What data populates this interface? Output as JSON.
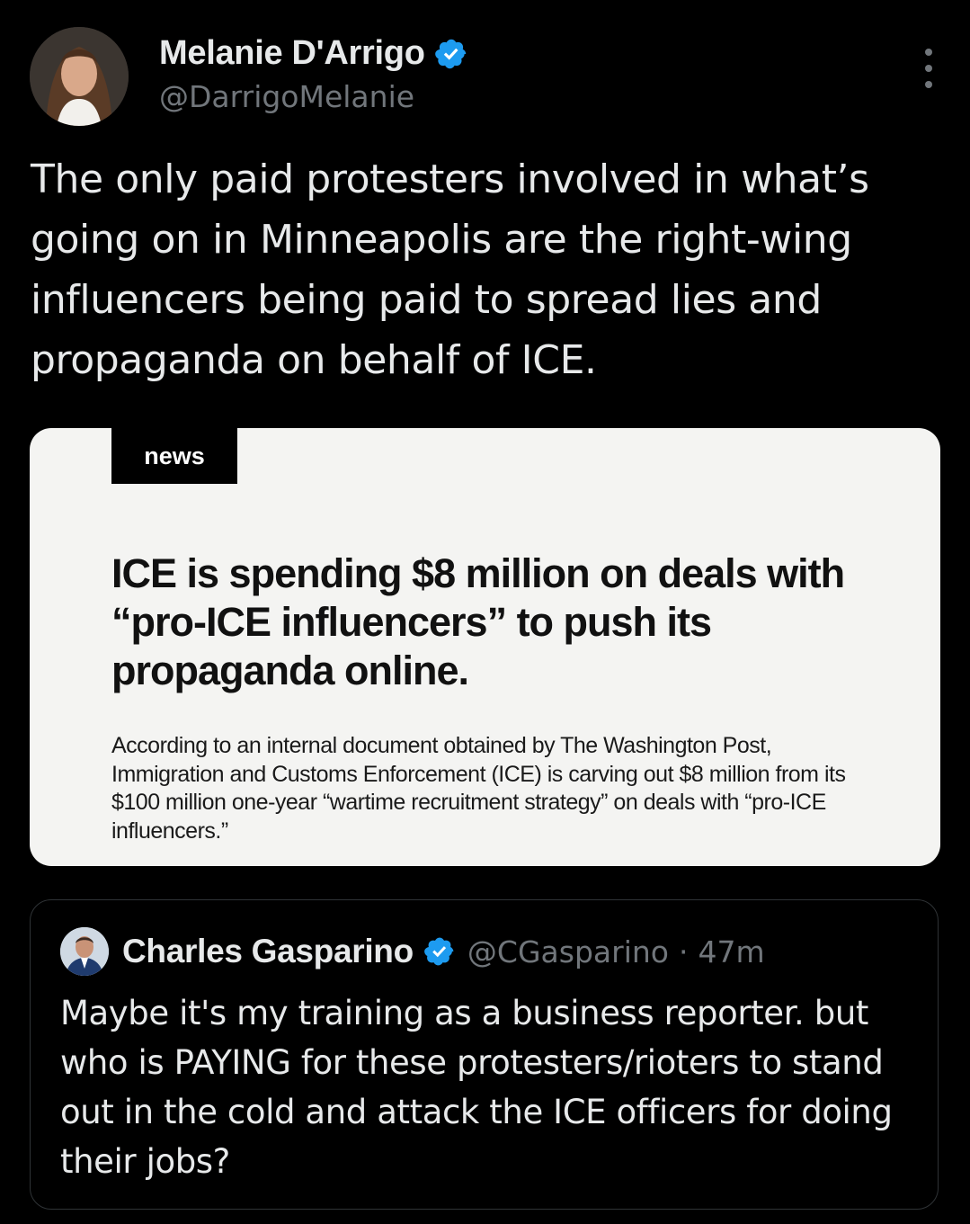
{
  "author": {
    "name": "Melanie D'Arrigo",
    "handle": "@DarrigoMelanie"
  },
  "tweet": {
    "text": "The only paid protesters involved in what’s going on in Minneapolis are the right-wing influencers being paid to spread lies and propaganda on behalf of ICE."
  },
  "media": {
    "tag": "news",
    "headline": "ICE is spending $8 million on deals with “pro-ICE influencers” to push its propaganda online.",
    "body": "According to an internal document obtained by The Washington Post, Immigration and Customs Enforcement (ICE) is carving out $8 million from its $100 million one-year “wartime recruitment strategy” on deals with “pro-ICE influencers.”"
  },
  "quote": {
    "name": "Charles Gasparino",
    "handle": "@CGasparino",
    "separator": "·",
    "time": "47m",
    "text": "Maybe it's my training as a business reporter. but who is PAYING for these protesters/rioters to stand out in the cold and attack the ICE officers for doing their jobs?"
  },
  "colors": {
    "background": "#000000",
    "text_primary": "#e7e9ea",
    "text_secondary": "#71767b",
    "verified": "#1d9bf0",
    "card_border": "#2f3336",
    "media_bg": "#f4f4f2"
  },
  "icons": {
    "verified": "verified-badge-icon",
    "more": "more-options-icon"
  }
}
